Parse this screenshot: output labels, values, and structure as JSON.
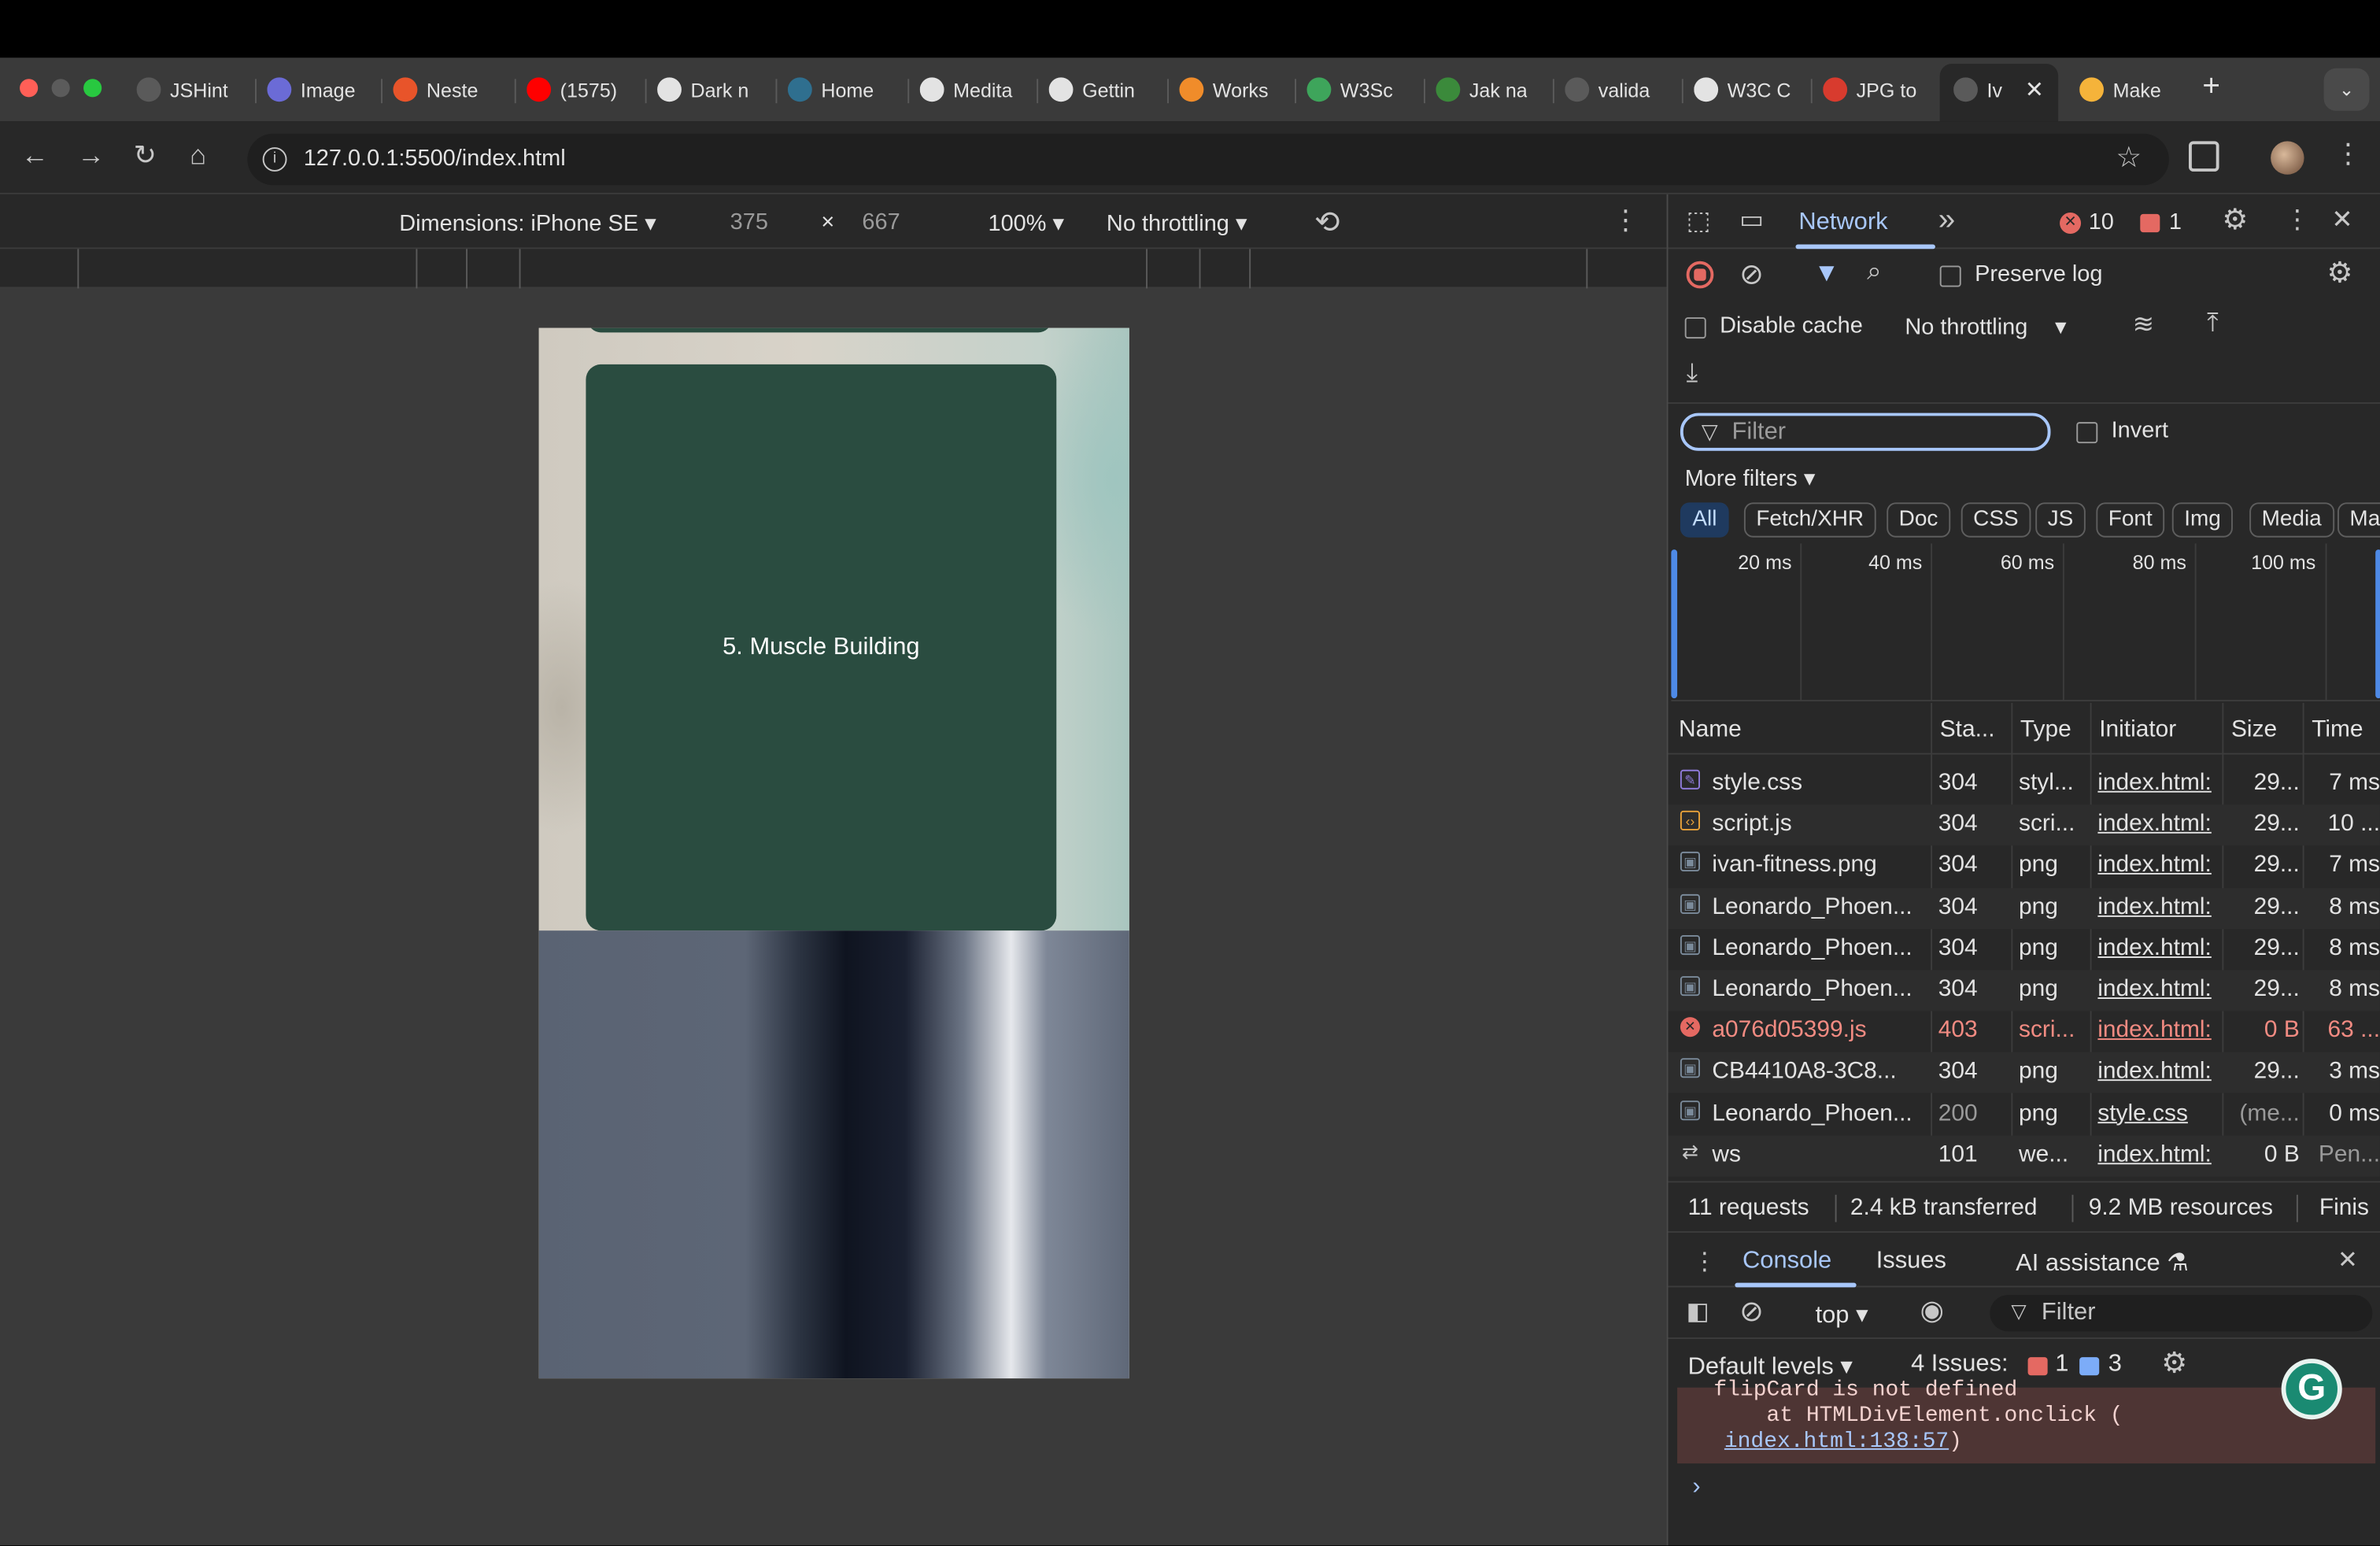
{
  "browser": {
    "tabs": [
      {
        "title": "JSHint",
        "icon": "globe-icon",
        "color": "#5a5a5a"
      },
      {
        "title": "Image",
        "icon": "image-globe-icon",
        "color": "#6b6bd6"
      },
      {
        "title": "Neste",
        "icon": "ring-icon",
        "color": "#e8542a"
      },
      {
        "title": "(1575)",
        "icon": "youtube-icon",
        "color": "#ff0000"
      },
      {
        "title": "Dark n",
        "icon": "openai-icon",
        "color": "#e3e3e3"
      },
      {
        "title": "Home",
        "icon": "ten-icon",
        "color": "#2f6f8f"
      },
      {
        "title": "Medita",
        "icon": "github-icon",
        "color": "#e3e3e3"
      },
      {
        "title": "Gettin",
        "icon": "github-icon",
        "color": "#e3e3e3"
      },
      {
        "title": "Works",
        "icon": "g-icon",
        "color": "#f08c2a"
      },
      {
        "title": "W3Sc",
        "icon": "w3-icon",
        "color": "#3ea55b"
      },
      {
        "title": "Jak na",
        "icon": "tools-icon",
        "color": "#3b8a3b"
      },
      {
        "title": "valida",
        "icon": "globe-icon",
        "color": "#5a5a5a"
      },
      {
        "title": "W3C C",
        "icon": "w3c-icon",
        "color": "#e3e3e3"
      },
      {
        "title": "JPG to",
        "icon": "jpg-icon",
        "color": "#d83b2e"
      },
      {
        "title": "Iv",
        "icon": "globe-icon",
        "color": "#5a5a5a",
        "active": true
      },
      {
        "title": "Make",
        "icon": "emoji-icon",
        "color": "#f5b33a"
      }
    ],
    "address": "127.0.0.1:5500/index.html"
  },
  "device_toolbar": {
    "dimensions_label": "Dimensions: iPhone SE",
    "width": "375",
    "times": "×",
    "height": "667",
    "zoom": "100%",
    "throttling": "No throttling"
  },
  "page": {
    "card_title": "5. Muscle Building",
    "card_color": "#2a4c40"
  },
  "devtools": {
    "active_panel": "Network",
    "error_count": "10",
    "issue_count": "1",
    "preserve_log": "Preserve log",
    "disable_cache": "Disable cache",
    "throttling": "No throttling",
    "filter_placeholder": "Filter",
    "invert": "Invert",
    "more_filters": "More filters",
    "type_filters": [
      "All",
      "Fetch/XHR",
      "Doc",
      "CSS",
      "JS",
      "Font",
      "Img",
      "Media",
      "Ma"
    ],
    "timeline_labels": [
      "20 ms",
      "40 ms",
      "60 ms",
      "80 ms",
      "100 ms"
    ],
    "columns": [
      "Name",
      "Sta...",
      "Type",
      "Initiator",
      "Size",
      "Time"
    ],
    "requests": [
      {
        "name": "style.css",
        "status": "304",
        "type": "styl...",
        "initiator": "index.html:",
        "size": "29...",
        "time": "7 ms",
        "icon": "css-file-icon",
        "error": false
      },
      {
        "name": "script.js",
        "status": "304",
        "type": "scri...",
        "initiator": "index.html:",
        "size": "29...",
        "time": "10 ...",
        "icon": "js-file-icon",
        "error": false
      },
      {
        "name": "ivan-fitness.png",
        "status": "304",
        "type": "png",
        "initiator": "index.html:",
        "size": "29...",
        "time": "7 ms",
        "icon": "image-file-icon",
        "error": false
      },
      {
        "name": "Leonardo_Phoen...",
        "status": "304",
        "type": "png",
        "initiator": "index.html:",
        "size": "29...",
        "time": "8 ms",
        "icon": "image-file-icon",
        "error": false
      },
      {
        "name": "Leonardo_Phoen...",
        "status": "304",
        "type": "png",
        "initiator": "index.html:",
        "size": "29...",
        "time": "8 ms",
        "icon": "image-file-icon",
        "error": false
      },
      {
        "name": "Leonardo_Phoen...",
        "status": "304",
        "type": "png",
        "initiator": "index.html:",
        "size": "29...",
        "time": "8 ms",
        "icon": "image-file-icon",
        "error": false
      },
      {
        "name": "a076d05399.js",
        "status": "403",
        "type": "scri...",
        "initiator": "index.html:",
        "size": "0 B",
        "time": "63 ...",
        "icon": "error-icon",
        "error": true
      },
      {
        "name": "CB4410A8-3C8...",
        "status": "304",
        "type": "png",
        "initiator": "index.html:",
        "size": "29...",
        "time": "3 ms",
        "icon": "image-file-icon",
        "error": false
      },
      {
        "name": "Leonardo_Phoen...",
        "status": "200",
        "type": "png",
        "initiator": "style.css",
        "size": "(me...",
        "time": "0 ms",
        "icon": "image-file-icon",
        "error": false
      },
      {
        "name": "ws",
        "status": "101",
        "type": "we...",
        "initiator": "index.html:",
        "size": "0 B",
        "time": "Pen...",
        "icon": "websocket-icon",
        "error": false
      }
    ],
    "summary": {
      "requests": "11 requests",
      "transferred": "2.4 kB transferred",
      "resources": "9.2 MB resources",
      "finish": "Finis"
    },
    "drawer": {
      "tabs": [
        "Console",
        "Issues",
        "AI assistance"
      ],
      "context": "top",
      "filter_placeholder": "Filter",
      "levels": "Default levels",
      "issues_label": "4 Issues:",
      "issues_errors": "1",
      "issues_info": "3",
      "error_line1": "flipCard is not defined",
      "error_line2": "    at HTMLDivElement.onclick (",
      "error_link": "index.html:138:57",
      "error_close": ")",
      "prompt": "›"
    }
  }
}
